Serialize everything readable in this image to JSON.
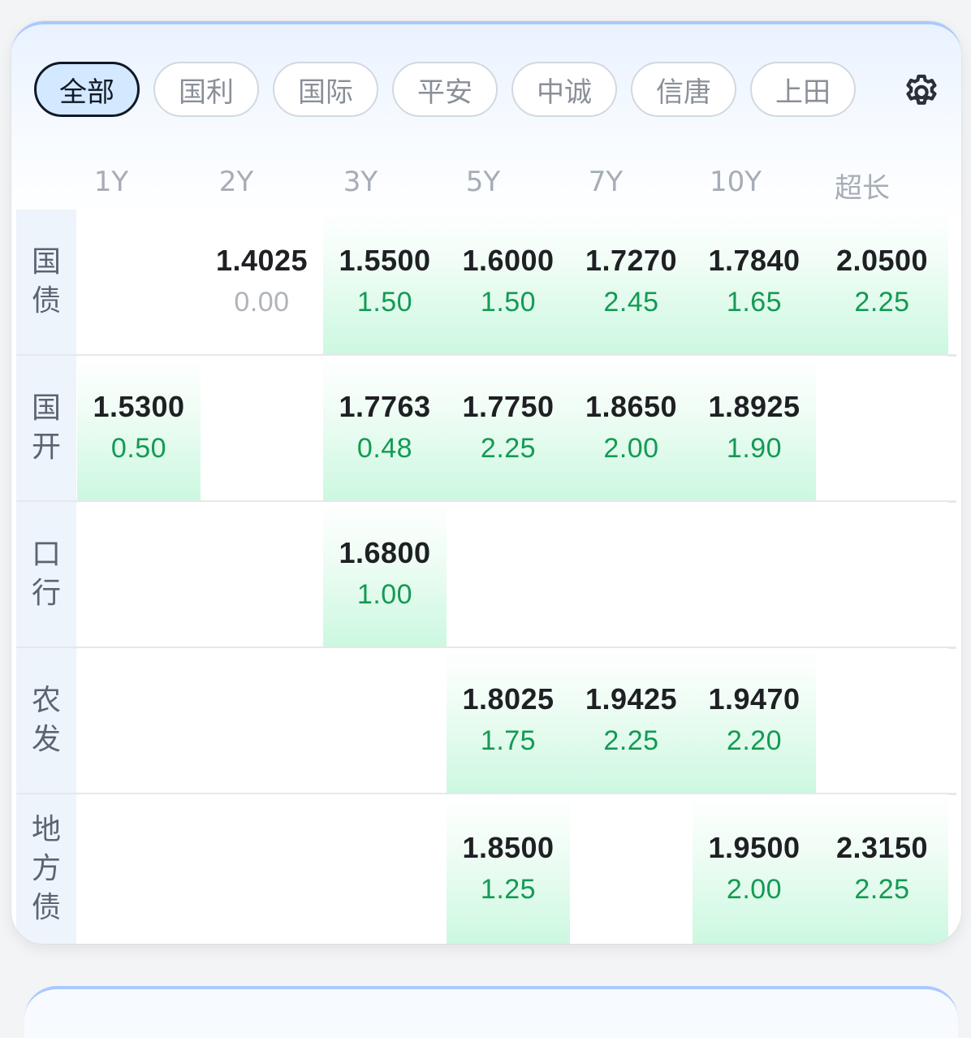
{
  "filters": {
    "items": [
      "全部",
      "国利",
      "国际",
      "平安",
      "中诚",
      "信唐",
      "上田"
    ],
    "active": "全部"
  },
  "settings_icon": "gear-icon",
  "colors": {
    "active_chip_bg": "#d3e9ff",
    "highlight_green": "#ccf8e0",
    "change_green": "#149a54",
    "zero_gray": "#b0b4bb"
  },
  "tenors": [
    "1Y",
    "2Y",
    "3Y",
    "5Y",
    "7Y",
    "10Y",
    "超长"
  ],
  "rows": [
    {
      "label": "国债",
      "cells": [
        null,
        {
          "yield": "1.4025",
          "change": "0.00"
        },
        {
          "yield": "1.5500",
          "change": "1.50"
        },
        {
          "yield": "1.6000",
          "change": "1.50"
        },
        {
          "yield": "1.7270",
          "change": "2.45"
        },
        {
          "yield": "1.7840",
          "change": "1.65"
        },
        {
          "yield": "2.0500",
          "change": "2.25"
        }
      ]
    },
    {
      "label": "国开",
      "cells": [
        {
          "yield": "1.5300",
          "change": "0.50"
        },
        null,
        {
          "yield": "1.7763",
          "change": "0.48"
        },
        {
          "yield": "1.7750",
          "change": "2.25"
        },
        {
          "yield": "1.8650",
          "change": "2.00"
        },
        {
          "yield": "1.8925",
          "change": "1.90"
        },
        null
      ]
    },
    {
      "label": "口行",
      "cells": [
        null,
        null,
        {
          "yield": "1.6800",
          "change": "1.00"
        },
        null,
        null,
        null,
        null
      ]
    },
    {
      "label": "农发",
      "cells": [
        null,
        null,
        null,
        {
          "yield": "1.8025",
          "change": "1.75"
        },
        {
          "yield": "1.9425",
          "change": "2.25"
        },
        {
          "yield": "1.9470",
          "change": "2.20"
        },
        null
      ]
    },
    {
      "label": "地方债",
      "cells": [
        null,
        null,
        null,
        {
          "yield": "1.8500",
          "change": "1.25"
        },
        null,
        {
          "yield": "1.9500",
          "change": "2.00"
        },
        {
          "yield": "2.3150",
          "change": "2.25"
        }
      ]
    }
  ]
}
